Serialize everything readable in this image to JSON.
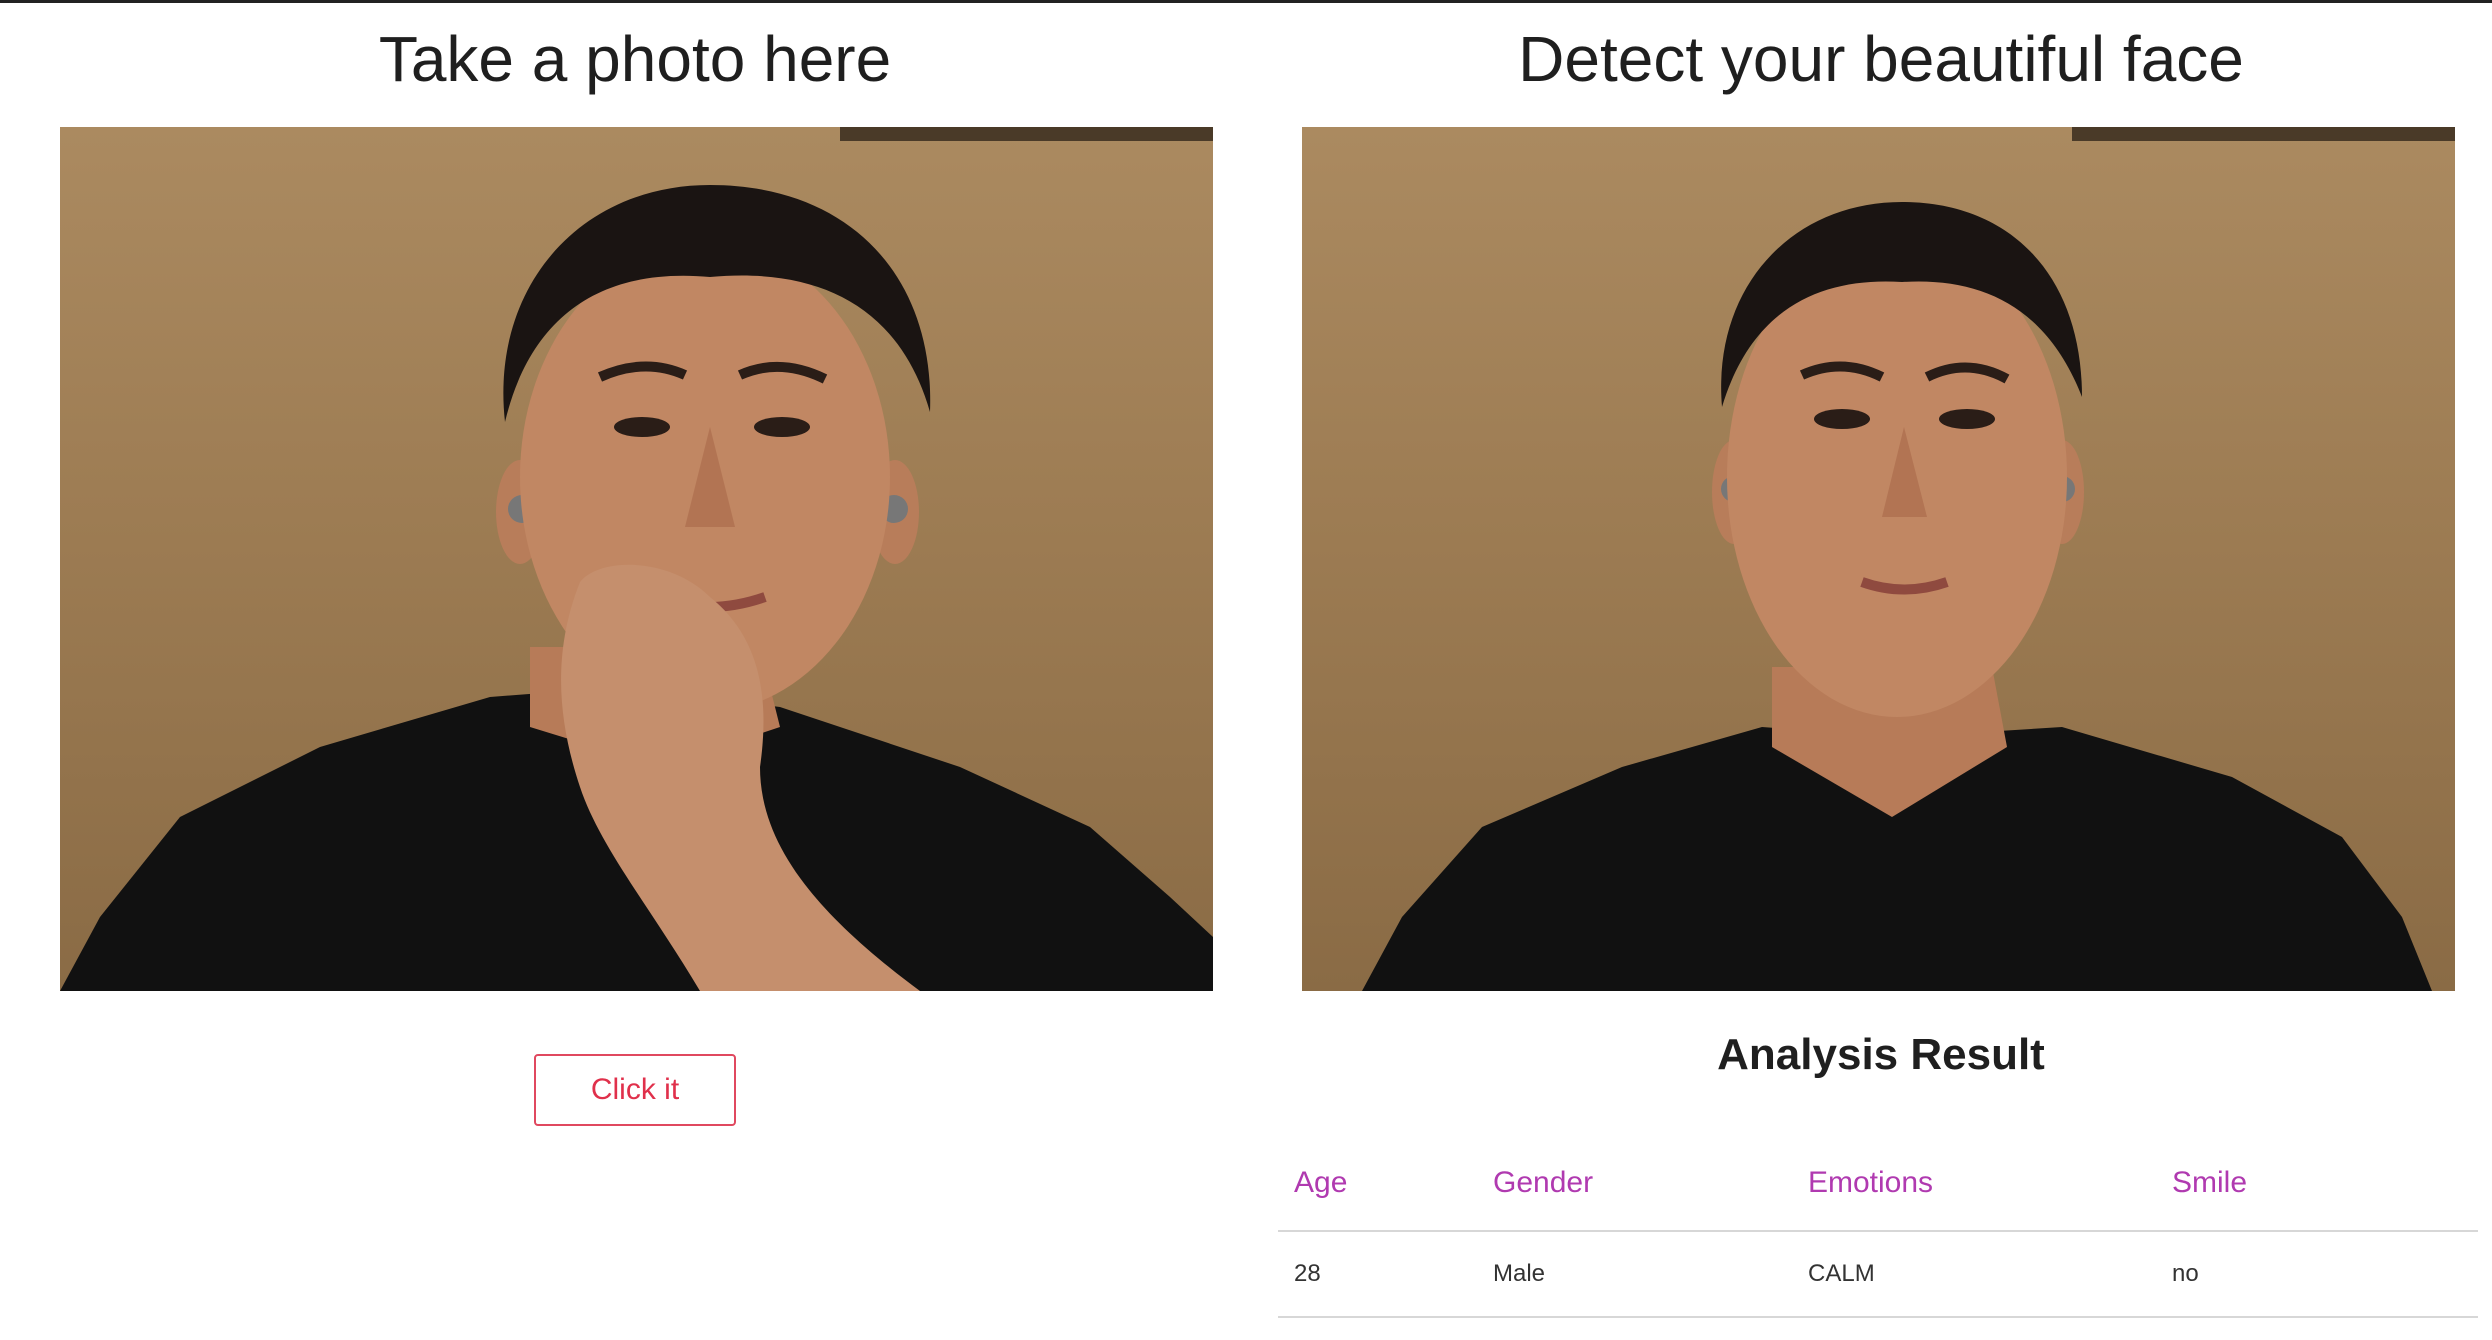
{
  "left": {
    "title": "Take a photo here",
    "button_label": "Click it"
  },
  "right": {
    "title": "Detect your beautiful face",
    "result_title": "Analysis Result",
    "table": {
      "headers": [
        "Age",
        "Gender",
        "Emotions",
        "Smile"
      ],
      "rows": [
        [
          "28",
          "Male",
          "CALM",
          "no"
        ]
      ]
    }
  },
  "colors": {
    "accent": "#e0304b",
    "header_text": "#b03ab0",
    "photo_bg": "#a3835a"
  }
}
